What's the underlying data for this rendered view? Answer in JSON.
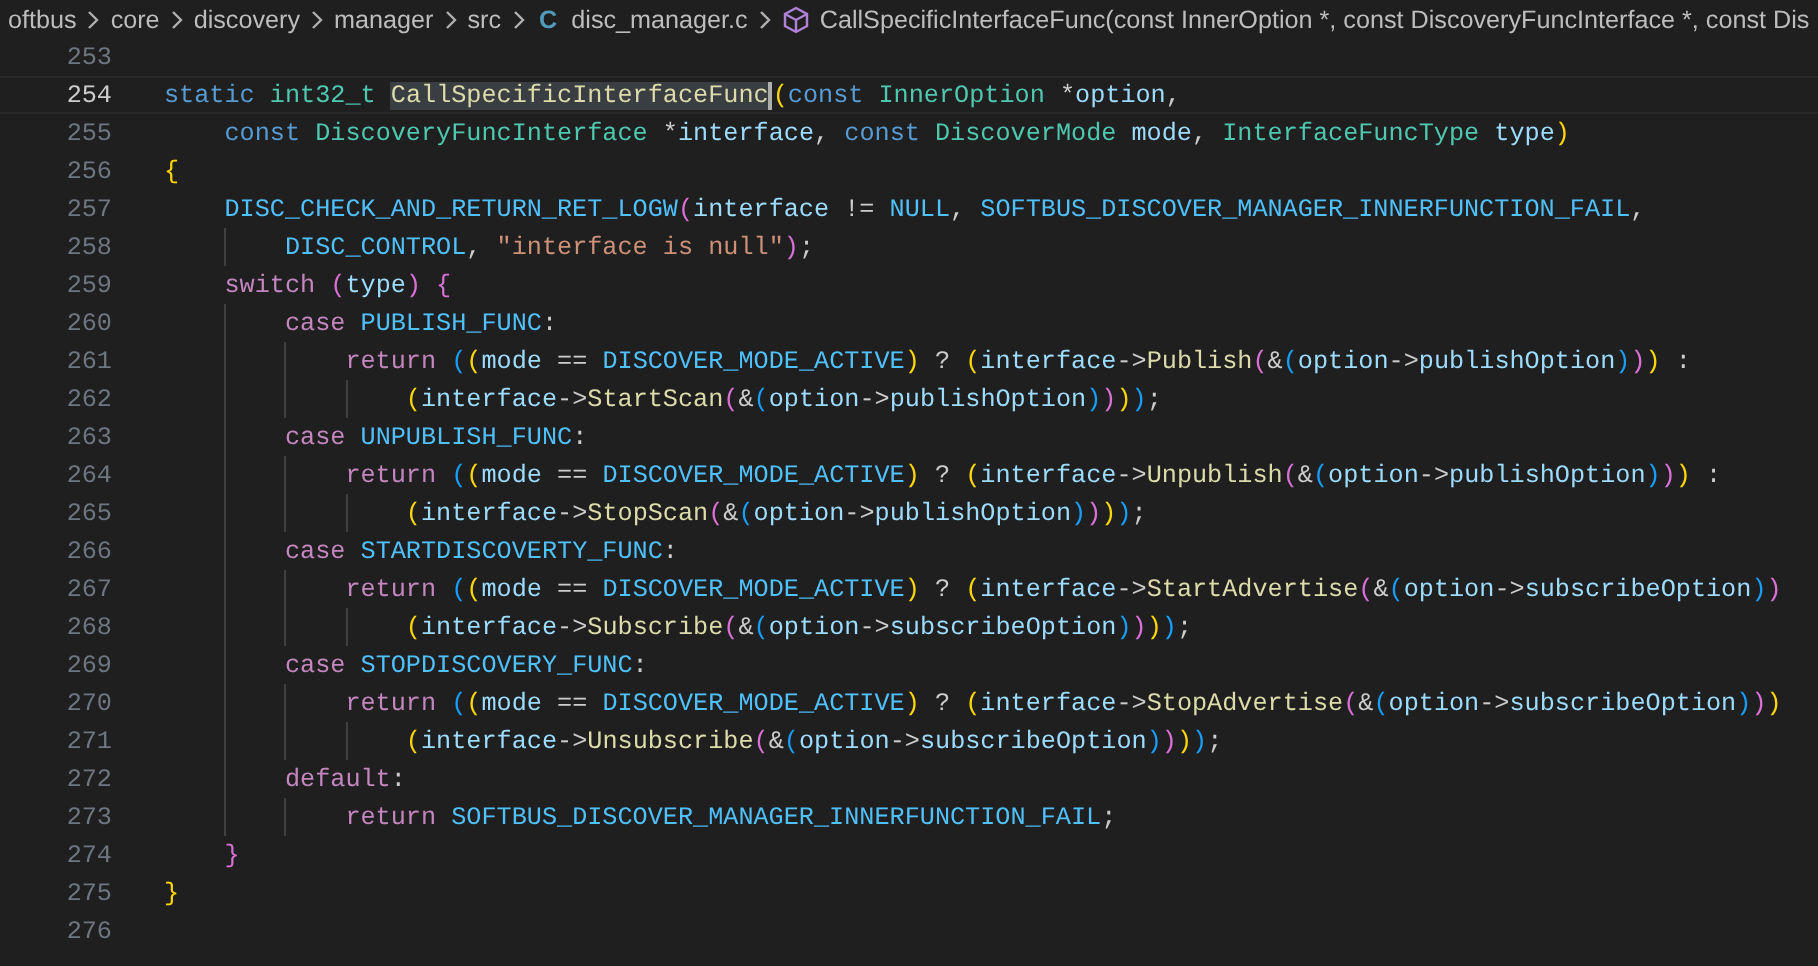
{
  "breadcrumb": [
    {
      "kind": "folder",
      "label": "oftbus"
    },
    {
      "kind": "folder",
      "label": "core"
    },
    {
      "kind": "folder",
      "label": "discovery"
    },
    {
      "kind": "folder",
      "label": "manager"
    },
    {
      "kind": "folder",
      "label": "src"
    },
    {
      "kind": "file",
      "icon": "C",
      "label": "disc_manager.c"
    },
    {
      "kind": "symbol",
      "label": "CallSpecificInterfaceFunc(const InnerOption *, const DiscoveryFuncInterface *, const Dis"
    }
  ],
  "lines": [
    {
      "number": "253",
      "current": false
    },
    {
      "number": "254",
      "current": true,
      "tokens": [
        {
          "text": "static",
          "kind": "kw"
        },
        {
          "text": " int32_t",
          "kind": "type"
        },
        {
          "text": " CallSpecificInterfaceFunc",
          "kind": "match"
        },
        {
          "text": "(",
          "kind": "br1"
        },
        {
          "text": "const",
          "kind": "kw"
        },
        {
          "text": " InnerOption",
          "kind": "type"
        },
        {
          "text": " *",
          "kind": "plain"
        },
        {
          "text": "option",
          "kind": "var"
        },
        {
          "text": ",",
          "kind": "plain"
        }
      ]
    },
    {
      "number": "255",
      "current": false,
      "tokens": [
        {
          "text": "    const",
          "kind": "kw"
        },
        {
          "text": " DiscoveryFuncInterface",
          "kind": "type"
        },
        {
          "text": " *",
          "kind": "plain"
        },
        {
          "text": "interface",
          "kind": "var"
        },
        {
          "text": ", ",
          "kind": "plain"
        },
        {
          "text": "const",
          "kind": "kw"
        },
        {
          "text": " DiscoverMode",
          "kind": "type"
        },
        {
          "text": " mode",
          "kind": "var"
        },
        {
          "text": ", ",
          "kind": "plain"
        },
        {
          "text": "InterfaceFuncType",
          "kind": "type"
        },
        {
          "text": " type",
          "kind": "var"
        },
        {
          "text": ")",
          "kind": "br1"
        }
      ]
    },
    {
      "number": "256",
      "current": false,
      "tokens": [
        {
          "text": "{",
          "kind": "br1"
        }
      ]
    },
    {
      "number": "257",
      "current": false,
      "tokens": [
        {
          "text": "    DISC_CHECK_AND_RETURN_RET_LOGW",
          "kind": "macro"
        },
        {
          "text": "(",
          "kind": "br2"
        },
        {
          "text": "interface",
          "kind": "var"
        },
        {
          "text": " != ",
          "kind": "plain"
        },
        {
          "text": "NULL",
          "kind": "macro"
        },
        {
          "text": ", ",
          "kind": "plain"
        },
        {
          "text": "SOFTBUS_DISCOVER_MANAGER_INNERFUNCTION_FAIL",
          "kind": "macro"
        },
        {
          "text": ",",
          "kind": "plain"
        }
      ]
    },
    {
      "number": "258",
      "current": false,
      "tokens": [
        {
          "text": "        DISC_CONTROL",
          "kind": "macro"
        },
        {
          "text": ", ",
          "kind": "plain"
        },
        {
          "text": "\"interface is null\"",
          "kind": "str"
        },
        {
          "text": ")",
          "kind": "br2"
        },
        {
          "text": ";",
          "kind": "plain"
        }
      ]
    },
    {
      "number": "259",
      "current": false,
      "tokens": [
        {
          "text": "    switch",
          "kind": "ctrl"
        },
        {
          "text": " (",
          "kind": "br2"
        },
        {
          "text": "type",
          "kind": "var"
        },
        {
          "text": ")",
          "kind": "br2"
        },
        {
          "text": " {",
          "kind": "br2"
        }
      ]
    },
    {
      "number": "260",
      "current": false,
      "tokens": [
        {
          "text": "        case",
          "kind": "ctrl"
        },
        {
          "text": " PUBLISH_FUNC",
          "kind": "macro"
        },
        {
          "text": ":",
          "kind": "plain"
        }
      ]
    },
    {
      "number": "261",
      "current": false,
      "tokens": [
        {
          "text": "            return",
          "kind": "ctrl"
        },
        {
          "text": " (",
          "kind": "br3"
        },
        {
          "text": "(",
          "kind": "br1"
        },
        {
          "text": "mode",
          "kind": "var"
        },
        {
          "text": " == ",
          "kind": "plain"
        },
        {
          "text": "DISCOVER_MODE_ACTIVE",
          "kind": "macro"
        },
        {
          "text": ")",
          "kind": "br1"
        },
        {
          "text": " ? ",
          "kind": "plain"
        },
        {
          "text": "(",
          "kind": "br1"
        },
        {
          "text": "interface",
          "kind": "var"
        },
        {
          "text": "->",
          "kind": "plain"
        },
        {
          "text": "Publish",
          "kind": "fn"
        },
        {
          "text": "(",
          "kind": "br2"
        },
        {
          "text": "&",
          "kind": "plain"
        },
        {
          "text": "(",
          "kind": "br3"
        },
        {
          "text": "option",
          "kind": "var"
        },
        {
          "text": "->",
          "kind": "plain"
        },
        {
          "text": "publishOption",
          "kind": "var"
        },
        {
          "text": ")",
          "kind": "br3"
        },
        {
          "text": ")",
          "kind": "br2"
        },
        {
          "text": ")",
          "kind": "br1"
        },
        {
          "text": " :",
          "kind": "plain"
        }
      ]
    },
    {
      "number": "262",
      "current": false,
      "tokens": [
        {
          "text": "                (",
          "kind": "br1"
        },
        {
          "text": "interface",
          "kind": "var"
        },
        {
          "text": "->",
          "kind": "plain"
        },
        {
          "text": "StartScan",
          "kind": "fn"
        },
        {
          "text": "(",
          "kind": "br2"
        },
        {
          "text": "&",
          "kind": "plain"
        },
        {
          "text": "(",
          "kind": "br3"
        },
        {
          "text": "option",
          "kind": "var"
        },
        {
          "text": "->",
          "kind": "plain"
        },
        {
          "text": "publishOption",
          "kind": "var"
        },
        {
          "text": ")",
          "kind": "br3"
        },
        {
          "text": ")",
          "kind": "br2"
        },
        {
          "text": ")",
          "kind": "br1"
        },
        {
          "text": ")",
          "kind": "br3"
        },
        {
          "text": ";",
          "kind": "plain"
        }
      ]
    },
    {
      "number": "263",
      "current": false,
      "tokens": [
        {
          "text": "        case",
          "kind": "ctrl"
        },
        {
          "text": " UNPUBLISH_FUNC",
          "kind": "macro"
        },
        {
          "text": ":",
          "kind": "plain"
        }
      ]
    },
    {
      "number": "264",
      "current": false,
      "tokens": [
        {
          "text": "            return",
          "kind": "ctrl"
        },
        {
          "text": " (",
          "kind": "br3"
        },
        {
          "text": "(",
          "kind": "br1"
        },
        {
          "text": "mode",
          "kind": "var"
        },
        {
          "text": " == ",
          "kind": "plain"
        },
        {
          "text": "DISCOVER_MODE_ACTIVE",
          "kind": "macro"
        },
        {
          "text": ")",
          "kind": "br1"
        },
        {
          "text": " ? ",
          "kind": "plain"
        },
        {
          "text": "(",
          "kind": "br1"
        },
        {
          "text": "interface",
          "kind": "var"
        },
        {
          "text": "->",
          "kind": "plain"
        },
        {
          "text": "Unpublish",
          "kind": "fn"
        },
        {
          "text": "(",
          "kind": "br2"
        },
        {
          "text": "&",
          "kind": "plain"
        },
        {
          "text": "(",
          "kind": "br3"
        },
        {
          "text": "option",
          "kind": "var"
        },
        {
          "text": "->",
          "kind": "plain"
        },
        {
          "text": "publishOption",
          "kind": "var"
        },
        {
          "text": ")",
          "kind": "br3"
        },
        {
          "text": ")",
          "kind": "br2"
        },
        {
          "text": ")",
          "kind": "br1"
        },
        {
          "text": " :",
          "kind": "plain"
        }
      ]
    },
    {
      "number": "265",
      "current": false,
      "tokens": [
        {
          "text": "                (",
          "kind": "br1"
        },
        {
          "text": "interface",
          "kind": "var"
        },
        {
          "text": "->",
          "kind": "plain"
        },
        {
          "text": "StopScan",
          "kind": "fn"
        },
        {
          "text": "(",
          "kind": "br2"
        },
        {
          "text": "&",
          "kind": "plain"
        },
        {
          "text": "(",
          "kind": "br3"
        },
        {
          "text": "option",
          "kind": "var"
        },
        {
          "text": "->",
          "kind": "plain"
        },
        {
          "text": "publishOption",
          "kind": "var"
        },
        {
          "text": ")",
          "kind": "br3"
        },
        {
          "text": ")",
          "kind": "br2"
        },
        {
          "text": ")",
          "kind": "br1"
        },
        {
          "text": ")",
          "kind": "br3"
        },
        {
          "text": ";",
          "kind": "plain"
        }
      ]
    },
    {
      "number": "266",
      "current": false,
      "tokens": [
        {
          "text": "        case",
          "kind": "ctrl"
        },
        {
          "text": " STARTDISCOVERTY_FUNC",
          "kind": "macro"
        },
        {
          "text": ":",
          "kind": "plain"
        }
      ]
    },
    {
      "number": "267",
      "current": false,
      "tokens": [
        {
          "text": "            return",
          "kind": "ctrl"
        },
        {
          "text": " (",
          "kind": "br3"
        },
        {
          "text": "(",
          "kind": "br1"
        },
        {
          "text": "mode",
          "kind": "var"
        },
        {
          "text": " == ",
          "kind": "plain"
        },
        {
          "text": "DISCOVER_MODE_ACTIVE",
          "kind": "macro"
        },
        {
          "text": ")",
          "kind": "br1"
        },
        {
          "text": " ? ",
          "kind": "plain"
        },
        {
          "text": "(",
          "kind": "br1"
        },
        {
          "text": "interface",
          "kind": "var"
        },
        {
          "text": "->",
          "kind": "plain"
        },
        {
          "text": "StartAdvertise",
          "kind": "fn"
        },
        {
          "text": "(",
          "kind": "br2"
        },
        {
          "text": "&",
          "kind": "plain"
        },
        {
          "text": "(",
          "kind": "br3"
        },
        {
          "text": "option",
          "kind": "var"
        },
        {
          "text": "->",
          "kind": "plain"
        },
        {
          "text": "subscribeOption",
          "kind": "var"
        },
        {
          "text": ")",
          "kind": "br3"
        },
        {
          "text": ")",
          "kind": "br2"
        }
      ]
    },
    {
      "number": "268",
      "current": false,
      "tokens": [
        {
          "text": "                (",
          "kind": "br1"
        },
        {
          "text": "interface",
          "kind": "var"
        },
        {
          "text": "->",
          "kind": "plain"
        },
        {
          "text": "Subscribe",
          "kind": "fn"
        },
        {
          "text": "(",
          "kind": "br2"
        },
        {
          "text": "&",
          "kind": "plain"
        },
        {
          "text": "(",
          "kind": "br3"
        },
        {
          "text": "option",
          "kind": "var"
        },
        {
          "text": "->",
          "kind": "plain"
        },
        {
          "text": "subscribeOption",
          "kind": "var"
        },
        {
          "text": ")",
          "kind": "br3"
        },
        {
          "text": ")",
          "kind": "br2"
        },
        {
          "text": ")",
          "kind": "br1"
        },
        {
          "text": ")",
          "kind": "br3"
        },
        {
          "text": ";",
          "kind": "plain"
        }
      ]
    },
    {
      "number": "269",
      "current": false,
      "tokens": [
        {
          "text": "        case",
          "kind": "ctrl"
        },
        {
          "text": " STOPDISCOVERY_FUNC",
          "kind": "macro"
        },
        {
          "text": ":",
          "kind": "plain"
        }
      ]
    },
    {
      "number": "270",
      "current": false,
      "tokens": [
        {
          "text": "            return",
          "kind": "ctrl"
        },
        {
          "text": " (",
          "kind": "br3"
        },
        {
          "text": "(",
          "kind": "br1"
        },
        {
          "text": "mode",
          "kind": "var"
        },
        {
          "text": " == ",
          "kind": "plain"
        },
        {
          "text": "DISCOVER_MODE_ACTIVE",
          "kind": "macro"
        },
        {
          "text": ")",
          "kind": "br1"
        },
        {
          "text": " ? ",
          "kind": "plain"
        },
        {
          "text": "(",
          "kind": "br1"
        },
        {
          "text": "interface",
          "kind": "var"
        },
        {
          "text": "->",
          "kind": "plain"
        },
        {
          "text": "StopAdvertise",
          "kind": "fn"
        },
        {
          "text": "(",
          "kind": "br2"
        },
        {
          "text": "&",
          "kind": "plain"
        },
        {
          "text": "(",
          "kind": "br3"
        },
        {
          "text": "option",
          "kind": "var"
        },
        {
          "text": "->",
          "kind": "plain"
        },
        {
          "text": "subscribeOption",
          "kind": "var"
        },
        {
          "text": ")",
          "kind": "br3"
        },
        {
          "text": ")",
          "kind": "br2"
        },
        {
          "text": ")",
          "kind": "br1"
        }
      ]
    },
    {
      "number": "271",
      "current": false,
      "tokens": [
        {
          "text": "                (",
          "kind": "br1"
        },
        {
          "text": "interface",
          "kind": "var"
        },
        {
          "text": "->",
          "kind": "plain"
        },
        {
          "text": "Unsubscribe",
          "kind": "fn"
        },
        {
          "text": "(",
          "kind": "br2"
        },
        {
          "text": "&",
          "kind": "plain"
        },
        {
          "text": "(",
          "kind": "br3"
        },
        {
          "text": "option",
          "kind": "var"
        },
        {
          "text": "->",
          "kind": "plain"
        },
        {
          "text": "subscribeOption",
          "kind": "var"
        },
        {
          "text": ")",
          "kind": "br3"
        },
        {
          "text": ")",
          "kind": "br2"
        },
        {
          "text": ")",
          "kind": "br1"
        },
        {
          "text": ")",
          "kind": "br3"
        },
        {
          "text": ";",
          "kind": "plain"
        }
      ]
    },
    {
      "number": "272",
      "current": false,
      "tokens": [
        {
          "text": "        default",
          "kind": "ctrl"
        },
        {
          "text": ":",
          "kind": "plain"
        }
      ]
    },
    {
      "number": "273",
      "current": false,
      "tokens": [
        {
          "text": "            return",
          "kind": "ctrl"
        },
        {
          "text": " SOFTBUS_DISCOVER_MANAGER_INNERFUNCTION_FAIL",
          "kind": "macro"
        },
        {
          "text": ";",
          "kind": "plain"
        }
      ]
    },
    {
      "number": "274",
      "current": false,
      "tokens": [
        {
          "text": "    }",
          "kind": "br2"
        }
      ]
    },
    {
      "number": "275",
      "current": false,
      "tokens": [
        {
          "text": "}",
          "kind": "br1"
        }
      ]
    },
    {
      "number": "276",
      "current": false
    }
  ]
}
